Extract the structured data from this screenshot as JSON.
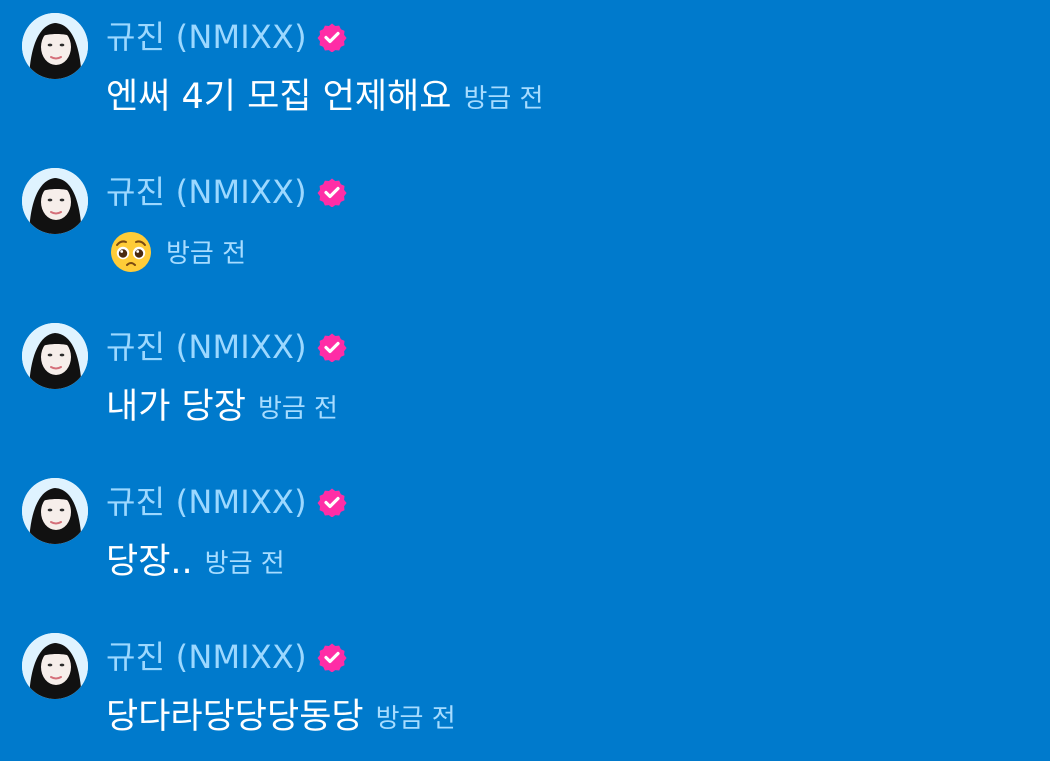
{
  "messages": [
    {
      "author": "규진 (NMIXX)",
      "text": "엔써 4기 모집 언제해요",
      "time": "방금 전"
    },
    {
      "author": "규진 (NMIXX)",
      "emoji": "pleading-face-icon",
      "time": "방금 전"
    },
    {
      "author": "규진 (NMIXX)",
      "text": "내가 당장",
      "time": "방금 전"
    },
    {
      "author": "규진 (NMIXX)",
      "text": "당장..",
      "time": "방금 전"
    },
    {
      "author": "규진 (NMIXX)",
      "text": "당다라당당당동당",
      "time": "방금 전"
    }
  ],
  "colors": {
    "background": "#007acc",
    "verified_badge": "#ff2da6",
    "name_text": "#9cd8ff",
    "time_text": "#a7dcff",
    "message_text": "#ffffff"
  }
}
